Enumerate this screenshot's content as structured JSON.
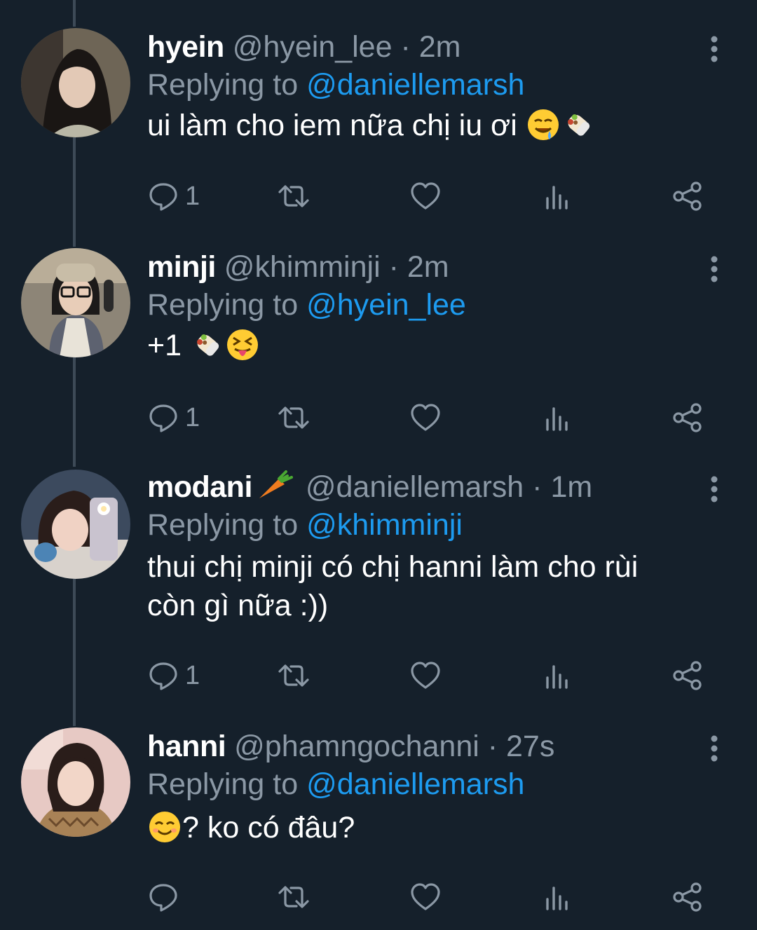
{
  "tweets": [
    {
      "name": "hyein",
      "handle": "@hyein_lee",
      "time": "· 2m",
      "replying_label": "Replying to",
      "replying_to": "@daniellemarsh",
      "text": "ui làm cho iem nữa chị iu ơi",
      "emojis": [
        "drooling-face",
        "burrito"
      ],
      "reply_count": "1"
    },
    {
      "name": "minji",
      "handle": "@khimminji",
      "time": "· 2m",
      "replying_label": "Replying to",
      "replying_to": "@hyein_lee",
      "text": "+1",
      "emojis": [
        "burrito",
        "squinting-tongue-face"
      ],
      "reply_count": "1"
    },
    {
      "name": "modani",
      "name_emoji": "carrot",
      "handle": "@daniellemarsh",
      "time": "· 1m",
      "replying_label": "Replying to",
      "replying_to": "@khimminji",
      "text_line1": "thui chị minji có chị hanni làm cho rùi",
      "text_line2": "còn gì nữa :))",
      "reply_count": "1"
    },
    {
      "name": "hanni",
      "handle": "@phamngochanni",
      "time": "· 27s",
      "replying_label": "Replying to",
      "replying_to": "@daniellemarsh",
      "emojis": [
        "smiling-face"
      ],
      "text": "? ko có đâu?",
      "reply_count": ""
    }
  ],
  "icons": [
    "reply-icon",
    "retweet-icon",
    "like-icon",
    "views-icon",
    "share-icon",
    "more-icon"
  ],
  "colors": {
    "background": "#15202b",
    "muted": "#8b98a5",
    "mention": "#1d9bf0",
    "thread_line": "#3d4a57"
  }
}
